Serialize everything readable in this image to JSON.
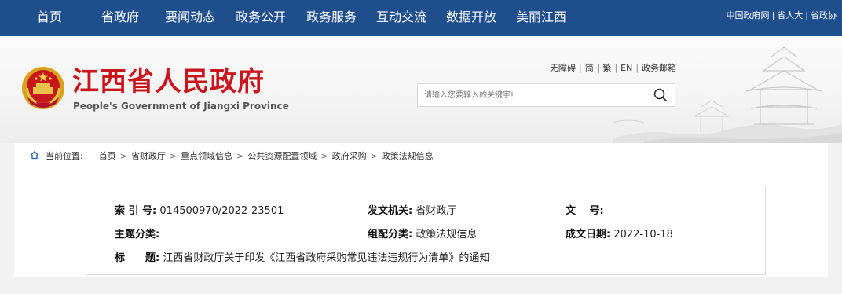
{
  "nav": {
    "items": [
      "首页",
      "省政府",
      "要闻动态",
      "政务公开",
      "政务服务",
      "互动交流",
      "数据开放",
      "美丽江西"
    ],
    "top_links": [
      "中国政府网",
      "省人大",
      "省政协"
    ]
  },
  "header": {
    "title": "江西省人民政府",
    "subtitle": "People's Government of Jiangxi Province",
    "util_links": [
      "无障碍",
      "简",
      "繁",
      "EN",
      "政务邮箱"
    ],
    "search_placeholder": "请输入您要输入的关键字!"
  },
  "breadcrumb": {
    "label": "当前位置:",
    "items": [
      "首页",
      "省财政厅",
      "重点领域信息",
      "公共资源配置领域",
      "政府采购",
      "政策法规信息"
    ]
  },
  "meta": {
    "index_label": "索 引 号:",
    "index_value": "014500970/2022-23501",
    "issuer_label": "发文机关:",
    "issuer_value": "省财政厅",
    "docno_label": "文　 号:",
    "docno_value": "",
    "topic_label": "主题分类:",
    "topic_value": "",
    "group_label": "组配分类:",
    "group_value": "政策法规信息",
    "date_label": "成文日期:",
    "date_value": "2022-10-18",
    "title_label": "标　　题:",
    "title_value": "江西省财政厅关于印发《江西省政府采购常见违法违规行为清单》的通知"
  },
  "colors": {
    "nav_bg": "#1f4e8c",
    "title_red": "#c8161d"
  }
}
